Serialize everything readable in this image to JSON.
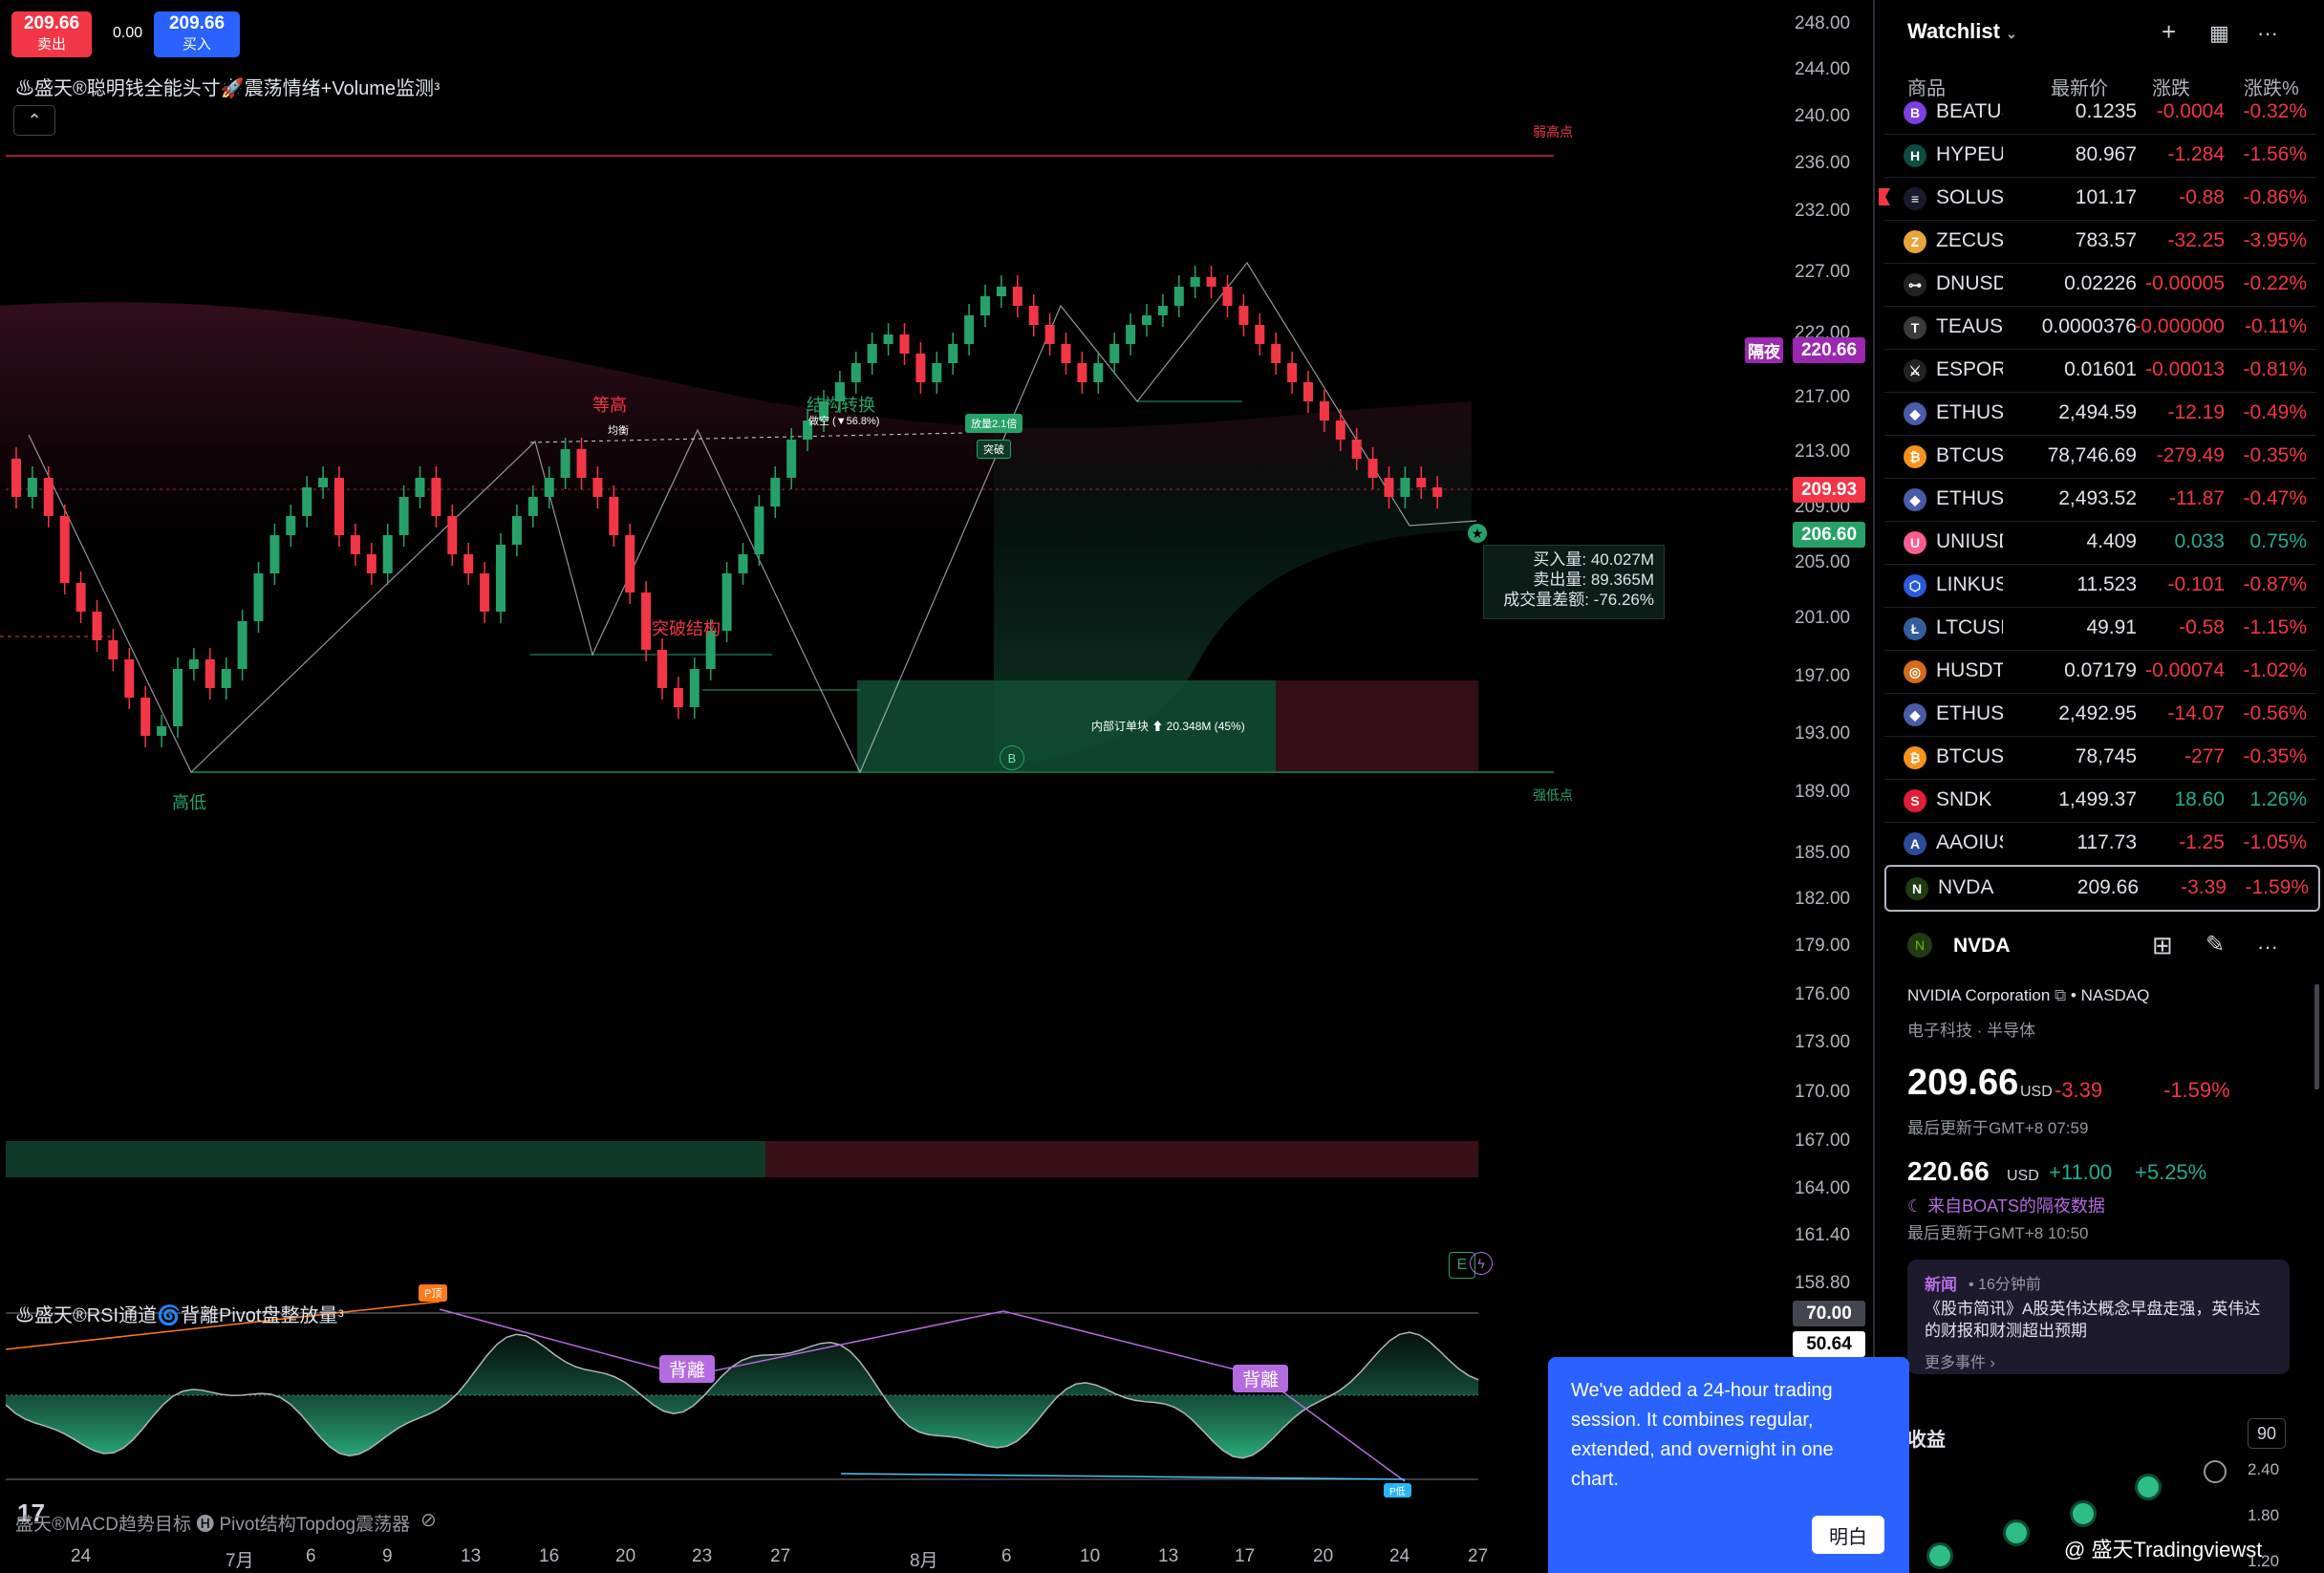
{
  "order_panel": {
    "sell_price": "209.66",
    "sell_label": "卖出",
    "spread": "0.00",
    "buy_price": "209.66",
    "buy_label": "买入"
  },
  "indicators": {
    "main": "♨盛天®聪明钱全能头寸🚀震荡情绪+Volume监测ᵌ",
    "rsi": "♨盛天®RSI通道🌀背離Pivot盘整放量ᵌ",
    "bottom": "盛天®MACD趋势目标 🅗 Pivot结构Topdog震荡器"
  },
  "price_axis": {
    "labels": [
      "248.00",
      "244.00",
      "240.00",
      "236.00",
      "232.00",
      "227.00",
      "222.00",
      "217.00",
      "213.00",
      "209.00",
      "205.00",
      "201.00",
      "197.00",
      "193.00",
      "189.00",
      "185.00",
      "182.00",
      "179.00",
      "176.00",
      "173.00",
      "170.00",
      "167.00",
      "164.00",
      "161.40",
      "158.80"
    ],
    "tags": {
      "overnight_label": "隔夜",
      "overnight": "220.66",
      "last": "209.93",
      "low": "206.60",
      "rsi_top": "70.00",
      "rsi_val": "50.64"
    }
  },
  "time_axis": [
    "24",
    "7月",
    "6",
    "9",
    "13",
    "16",
    "20",
    "23",
    "27",
    "8月",
    "6",
    "10",
    "13",
    "17",
    "20",
    "24",
    "27"
  ],
  "annotations": {
    "weak_high": "弱高点",
    "strong_low": "强低点",
    "equal_high": "等高",
    "mid": "均衡",
    "choch": "结构转换",
    "short": "做空 (▼56.8%)",
    "breakout": "突破结构",
    "surge": "放量2.1倍",
    "break": "突破",
    "low_high": "高低",
    "order_block": "内部订单块 ⬆ 20.348M (45%)",
    "ob_marker": "B",
    "vol_buy": "买入量: 40.027M",
    "vol_sell": "卖出量: 89.365M",
    "vol_diff": "成交量差额: -76.26%",
    "div1": "背離",
    "div2": "背離",
    "peak": "P顶",
    "trough": "P低",
    "e_icon": "E"
  },
  "watchlist": {
    "title": "Watchlist",
    "columns": [
      "商品",
      "最新价",
      "涨跌",
      "涨跌%"
    ],
    "rows": [
      {
        "sym": "BEATUS",
        "last": "0.1235",
        "chg": "-0.0004",
        "pct": "-0.32%",
        "dir": "neg",
        "icon": "B",
        "color": "#7b3fe4"
      },
      {
        "sym": "HYPEUS",
        "last": "80.967",
        "chg": "-1.284",
        "pct": "-1.56%",
        "dir": "neg",
        "icon": "H",
        "color": "#0b4d43"
      },
      {
        "sym": "SOLUSD",
        "last": "101.17",
        "chg": "-0.88",
        "pct": "-0.86%",
        "dir": "neg",
        "icon": "≡",
        "color": "#1a1a2e",
        "flag": true
      },
      {
        "sym": "ZECUSD",
        "last": "783.57",
        "chg": "-32.25",
        "pct": "-3.95%",
        "dir": "neg",
        "icon": "Z",
        "color": "#e8a33a"
      },
      {
        "sym": "DNUSDT",
        "last": "0.02226",
        "chg": "-0.00005",
        "pct": "-0.22%",
        "dir": "neg",
        "icon": "⊶",
        "color": "#222"
      },
      {
        "sym": "TEAUSD",
        "last": "0.0000376",
        "chg": "-0.000000",
        "pct": "-0.11%",
        "dir": "neg",
        "icon": "T",
        "color": "#3a3a3a"
      },
      {
        "sym": "ESPORTS",
        "last": "0.01601",
        "chg": "-0.00013",
        "pct": "-0.81%",
        "dir": "neg",
        "icon": "⚔",
        "color": "#222"
      },
      {
        "sym": "ETHUSD",
        "last": "2,494.59",
        "chg": "-12.19",
        "pct": "-0.49%",
        "dir": "neg",
        "icon": "◆",
        "color": "#4a5ba8"
      },
      {
        "sym": "BTCUSD",
        "last": "78,746.69",
        "chg": "-279.49",
        "pct": "-0.35%",
        "dir": "neg",
        "icon": "₿",
        "color": "#f7931a"
      },
      {
        "sym": "ETHUSD",
        "last": "2,493.52",
        "chg": "-11.87",
        "pct": "-0.47%",
        "dir": "neg",
        "icon": "◆",
        "color": "#4a5ba8"
      },
      {
        "sym": "UNIUSD",
        "last": "4.409",
        "chg": "0.033",
        "pct": "0.75%",
        "dir": "pos",
        "icon": "U",
        "color": "#ff5d8f"
      },
      {
        "sym": "LINKUSD",
        "last": "11.523",
        "chg": "-0.101",
        "pct": "-0.87%",
        "dir": "neg",
        "icon": "⬡",
        "color": "#2a5ada"
      },
      {
        "sym": "LTCUSD",
        "last": "49.91",
        "chg": "-0.58",
        "pct": "-1.15%",
        "dir": "neg",
        "icon": "Ł",
        "color": "#345d9d"
      },
      {
        "sym": "HUSDT",
        "last": "0.07179",
        "chg": "-0.00074",
        "pct": "-1.02%",
        "dir": "neg",
        "icon": "◎",
        "color": "#d86a1a"
      },
      {
        "sym": "ETHUSD",
        "last": "2,492.95",
        "chg": "-14.07",
        "pct": "-0.56%",
        "dir": "neg",
        "icon": "◆",
        "color": "#4a5ba8"
      },
      {
        "sym": "BTCUSD",
        "last": "78,745",
        "chg": "-277",
        "pct": "-0.35%",
        "dir": "neg",
        "icon": "₿",
        "color": "#f7931a"
      },
      {
        "sym": "SNDK",
        "last": "1,499.37",
        "chg": "18.60",
        "pct": "1.26%",
        "dir": "pos",
        "icon": "S",
        "color": "#e21d38"
      },
      {
        "sym": "AAOIUS",
        "last": "117.73",
        "chg": "-1.25",
        "pct": "-1.05%",
        "dir": "neg",
        "icon": "A",
        "color": "#2b4c9b"
      },
      {
        "sym": "NVDA",
        "last": "209.66",
        "chg": "-3.39",
        "pct": "-1.59%",
        "dir": "neg",
        "icon": "N",
        "color": "#1f3b12",
        "selected": true
      }
    ]
  },
  "detail": {
    "symbol": "NVDA",
    "company": "NVIDIA Corporation",
    "exchange": "NASDAQ",
    "sector": "电子科技 · 半导体",
    "price": "209.66",
    "currency": "USD",
    "change": "-3.39",
    "change_pct": "-1.59%",
    "updated": "最后更新于GMT+8 07:59",
    "ext_price": "220.66",
    "ext_currency": "USD",
    "ext_change": "+11.00",
    "ext_pct": "+5.25%",
    "ext_source": "来自BOATS的隔夜数据",
    "ext_updated": "最后更新于GMT+8 10:50",
    "news_label": "新闻",
    "news_time": "• 16分钟前",
    "news_title": "《股市简讯》A股英伟达概念早盘走强，英伟达的财报和财测超出预期",
    "news_more": "更多事件 ›",
    "earnings_label": "收益",
    "earnings_badge": "90",
    "earn_y1": "2.40",
    "earn_y2": "1.80",
    "earn_y3": "1.20"
  },
  "popup": {
    "text": "We've added a 24-hour trading session. It combines regular, extended, and overnight in one chart.",
    "button": "明白"
  },
  "watermark": "@ 盛天Tradingviewst",
  "colors": {
    "up": "#26a269",
    "down": "#f23645",
    "accent": "#2962ff",
    "purple": "#9c27b0"
  }
}
